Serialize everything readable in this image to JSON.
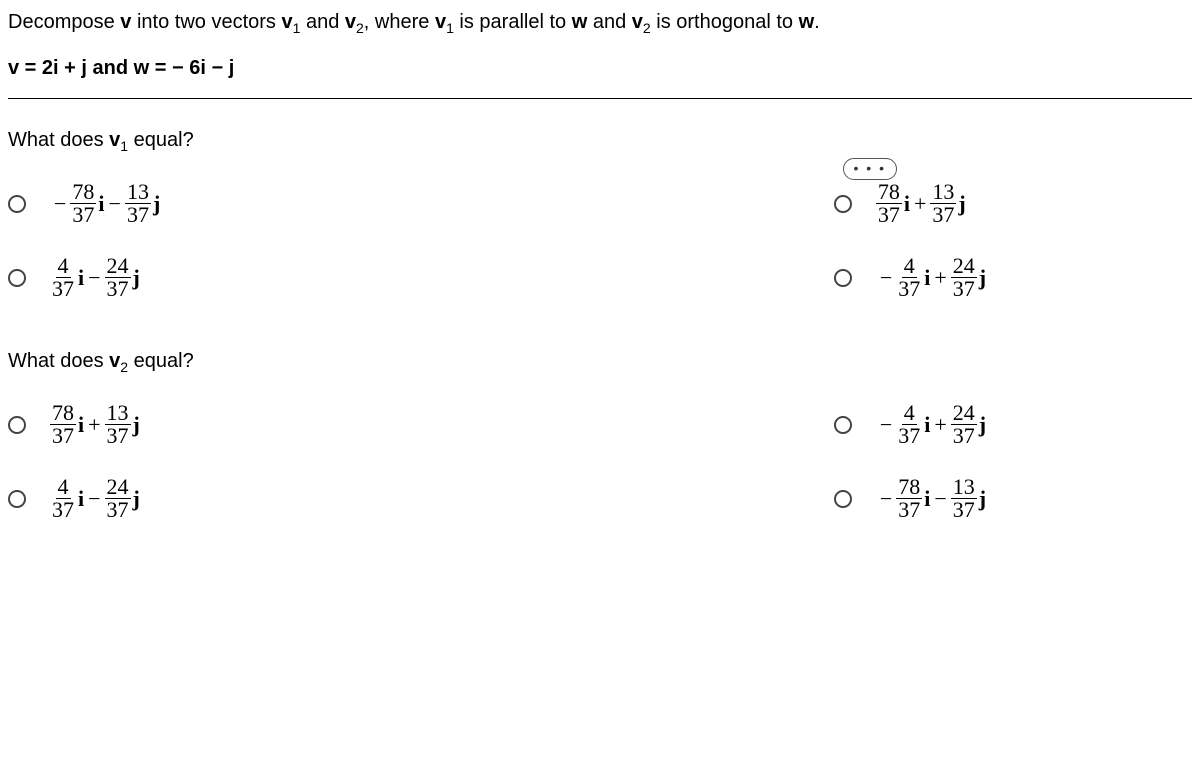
{
  "prompt_p1": "Decompose ",
  "v": "v",
  "prompt_p2": " into two vectors ",
  "v1_pre": "v",
  "v1_sub": "1",
  "and": " and ",
  "v2_pre": "v",
  "v2_sub": "2",
  "prompt_p3": ", where ",
  "prompt_p4": " is parallel to ",
  "w": "w",
  "prompt_p5": " and ",
  "prompt_p6": " is orthogonal to ",
  "given_v_lhs": "v",
  "given_eq1": " = 2",
  "i": "i",
  "given_p2": " + ",
  "j": "j",
  "given_and": " and ",
  "given_w_lhs": "w",
  "given_eq2": " = − 6",
  "given_minus": " − ",
  "ellipsis": "• • •",
  "q1": {
    "prompt_p1": "What does ",
    "prompt_p2": " equal?",
    "optA": {
      "n1": "78",
      "d1": "37",
      "n2": "13",
      "d2": "37"
    },
    "optB": {
      "n1": "78",
      "d1": "37",
      "n2": "13",
      "d2": "37"
    },
    "optC": {
      "n1": "4",
      "d1": "37",
      "n2": "24",
      "d2": "37"
    },
    "optD": {
      "n1": "4",
      "d1": "37",
      "n2": "24",
      "d2": "37"
    }
  },
  "q2": {
    "prompt_p1": "What does ",
    "prompt_p2": " equal?",
    "optA": {
      "n1": "78",
      "d1": "37",
      "n2": "13",
      "d2": "37"
    },
    "optB": {
      "n1": "4",
      "d1": "37",
      "n2": "24",
      "d2": "37"
    },
    "optC": {
      "n1": "4",
      "d1": "37",
      "n2": "24",
      "d2": "37"
    },
    "optD": {
      "n1": "78",
      "d1": "37",
      "n2": "13",
      "d2": "37"
    }
  }
}
